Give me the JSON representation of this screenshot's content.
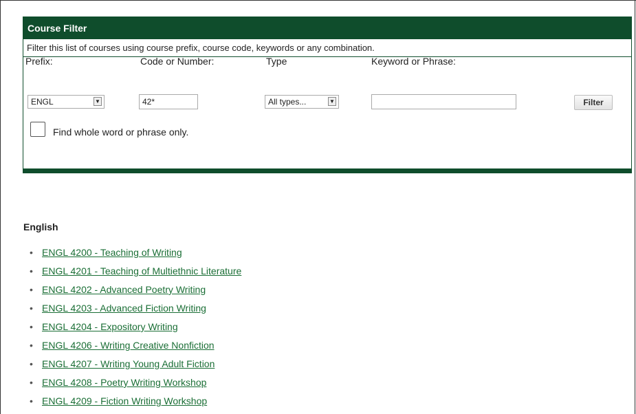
{
  "filter": {
    "title": "Course Filter",
    "description": "Filter this list of courses using course prefix, course code, keywords or any combination.",
    "prefix_label": "Prefix:",
    "code_label": "Code or Number:",
    "type_label": "Type",
    "keyword_label": "Keyword or Phrase:",
    "prefix_value": "ENGL",
    "code_value": "42*",
    "type_value": "All types...",
    "keyword_value": "",
    "filter_button": "Filter",
    "whole_word_label": "Find whole word or phrase only.",
    "whole_word_checked": false
  },
  "courses": {
    "heading": "English",
    "items": [
      {
        "label": "ENGL 4200 - Teaching of Writing"
      },
      {
        "label": "ENGL 4201 - Teaching of Multiethnic Literature"
      },
      {
        "label": "ENGL 4202 - Advanced Poetry Writing"
      },
      {
        "label": "ENGL 4203 - Advanced Fiction Writing"
      },
      {
        "label": "ENGL 4204 - Expository Writing"
      },
      {
        "label": "ENGL 4206 - Writing Creative Nonfiction"
      },
      {
        "label": "ENGL 4207 - Writing Young Adult Fiction"
      },
      {
        "label": "ENGL 4208 - Poetry Writing Workshop"
      },
      {
        "label": "ENGL 4209 - Fiction Writing Workshop"
      }
    ]
  },
  "colors": {
    "header_bg": "#0f4d2c",
    "link": "#1a6e35"
  },
  "icons": {
    "dropdown_arrow": "chevron-down-icon",
    "list_bullet": "bullet-icon"
  }
}
